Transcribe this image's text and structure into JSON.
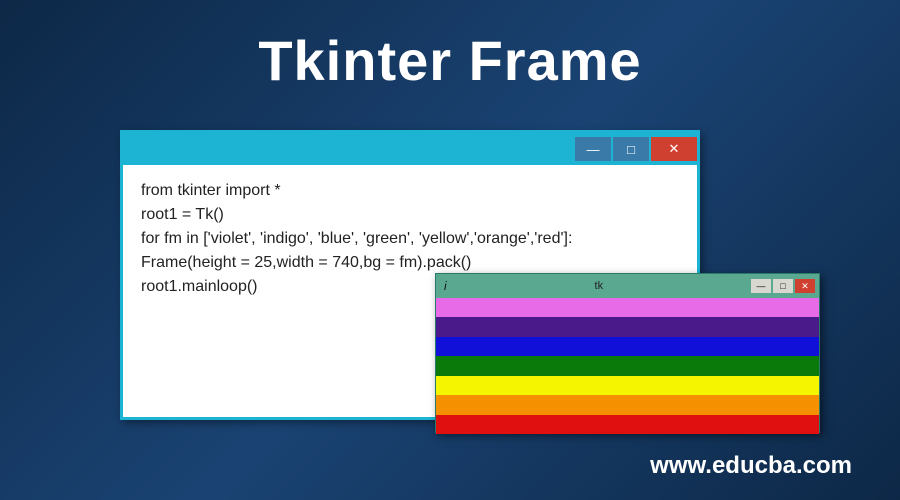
{
  "title": "Tkinter Frame",
  "footer": "www.educba.com",
  "code_window": {
    "lines": [
      "from tkinter import *",
      "root1 = Tk()",
      "for fm in ['violet', 'indigo', 'blue', 'green', 'yellow','orange','red']:",
      "Frame(height = 25,width = 740,bg = fm).pack()",
      "root1.mainloop()"
    ],
    "buttons": {
      "min": "—",
      "max": "□",
      "close": "✕"
    }
  },
  "output_window": {
    "icon": "i",
    "title": "tk",
    "buttons": {
      "min": "—",
      "max": "□",
      "close": "✕"
    },
    "stripes": [
      {
        "name": "violet",
        "color": "#e76be7"
      },
      {
        "name": "indigo",
        "color": "#4a1a8a"
      },
      {
        "name": "blue",
        "color": "#1010d8"
      },
      {
        "name": "green",
        "color": "#0a7a0a"
      },
      {
        "name": "yellow",
        "color": "#f5f500"
      },
      {
        "name": "orange",
        "color": "#f59000"
      },
      {
        "name": "red",
        "color": "#e01010"
      }
    ]
  }
}
